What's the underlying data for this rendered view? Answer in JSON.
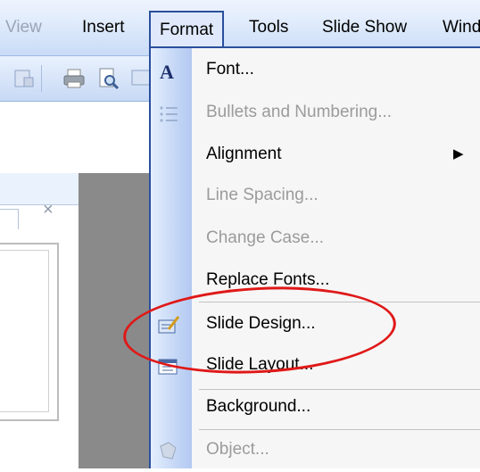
{
  "menubar": {
    "items": [
      "View",
      "Insert",
      "Format",
      "Tools",
      "Slide Show",
      "Wind"
    ],
    "active": "Format"
  },
  "panel": {
    "close_glyph": "×"
  },
  "format_menu": {
    "items": [
      {
        "label": "Font...",
        "icon": "font-a-icon",
        "enabled": true
      },
      {
        "label": "Bullets and Numbering...",
        "icon": "bullets-icon",
        "enabled": false
      },
      {
        "label": "Alignment",
        "icon": "",
        "enabled": true,
        "submenu": true
      },
      {
        "label": "Line Spacing...",
        "icon": "",
        "enabled": false
      },
      {
        "label": "Change Case...",
        "icon": "",
        "enabled": false
      },
      {
        "label": "Replace Fonts...",
        "icon": "",
        "enabled": true
      },
      {
        "label": "Slide Design...",
        "icon": "slide-design-icon",
        "enabled": true
      },
      {
        "label": "Slide Layout...",
        "icon": "slide-layout-icon",
        "enabled": true
      },
      {
        "label": "Background...",
        "icon": "",
        "enabled": true
      },
      {
        "label": "Object...",
        "icon": "object-icon",
        "enabled": false
      }
    ],
    "submenu_arrow": "▶"
  },
  "annotation": {
    "color": "#e01818",
    "highlighted_item": "Slide Design..."
  },
  "colors": {
    "menu_border": "#2a4f9c",
    "gutter": "#c5d7f6",
    "disabled_text": "#9b9b9b"
  }
}
